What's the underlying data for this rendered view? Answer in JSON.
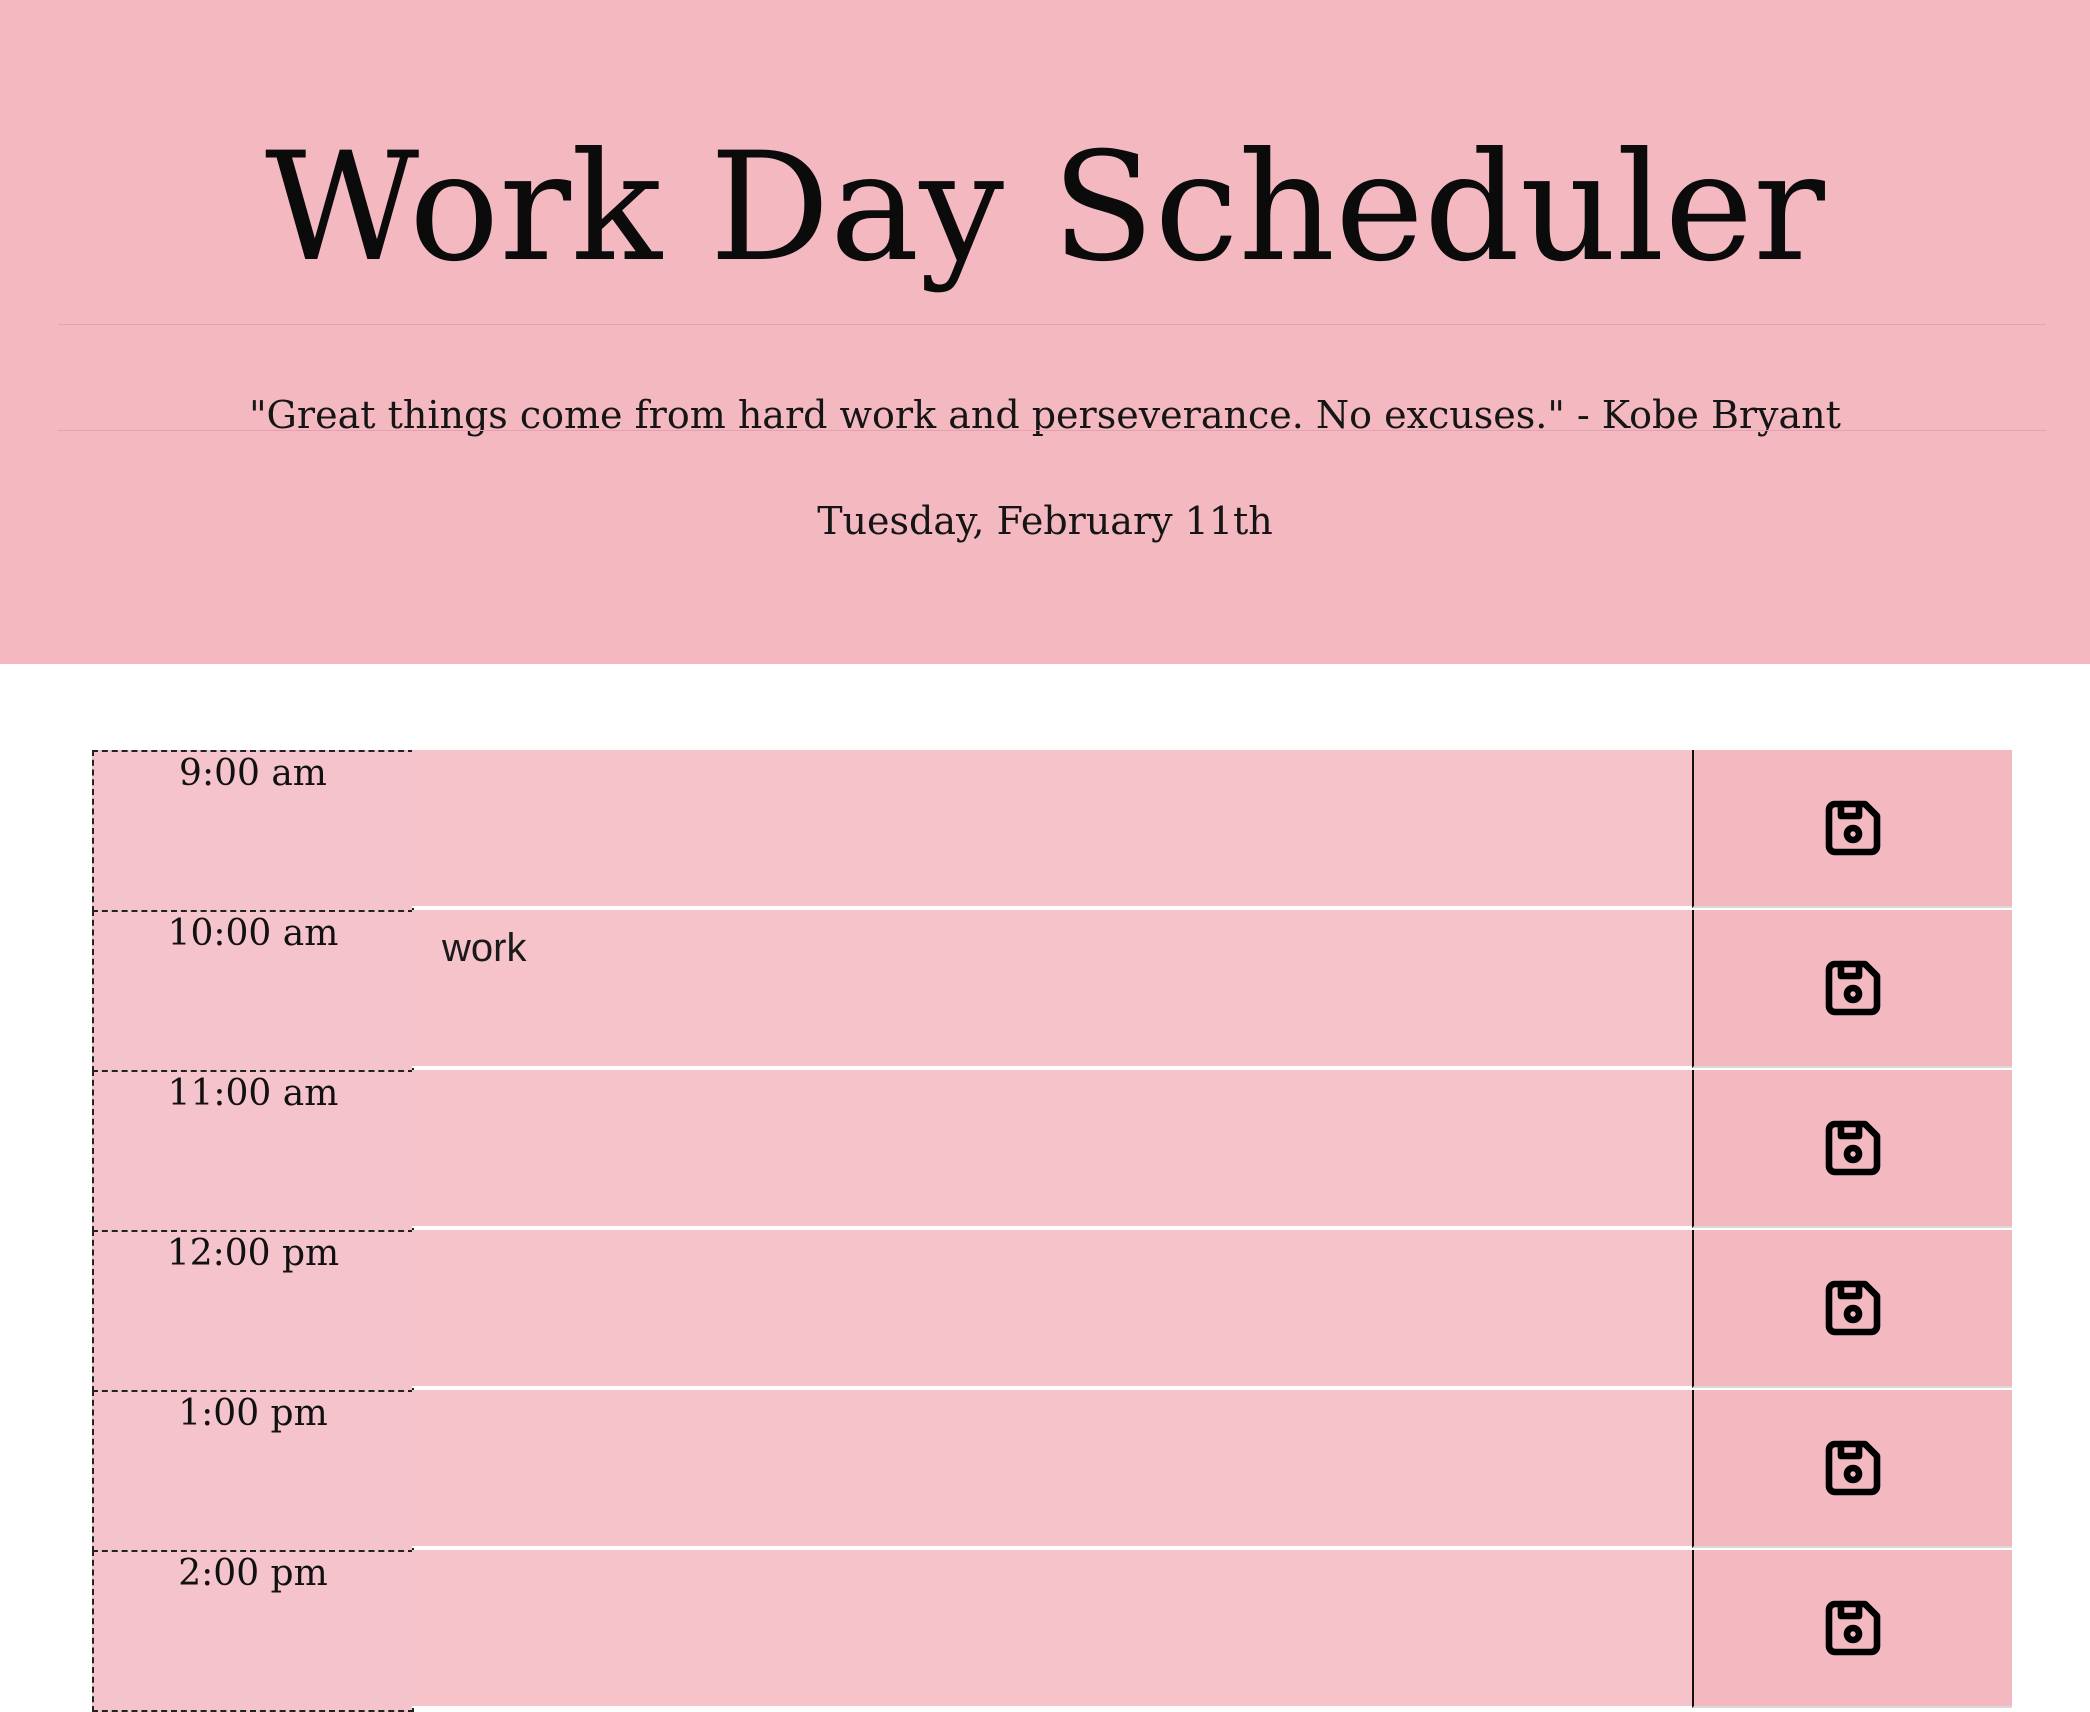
{
  "header": {
    "title": "Work Day Scheduler",
    "quote": "\"Great things come from hard work and perseverance. No excuses.\" - Kobe Bryant",
    "date": "Tuesday, February 11th"
  },
  "schedule": {
    "rows": [
      {
        "hour": "9:00 am",
        "text": ""
      },
      {
        "hour": "10:00 am",
        "text": "work"
      },
      {
        "hour": "11:00 am",
        "text": ""
      },
      {
        "hour": "12:00 pm",
        "text": ""
      },
      {
        "hour": "1:00 pm",
        "text": ""
      },
      {
        "hour": "2:00 pm",
        "text": ""
      }
    ],
    "save_icon": "save-icon"
  },
  "colors": {
    "header_background": "#f4b8c1",
    "row_background": "#f6c3cb",
    "save_background": "#f4b8c1"
  }
}
